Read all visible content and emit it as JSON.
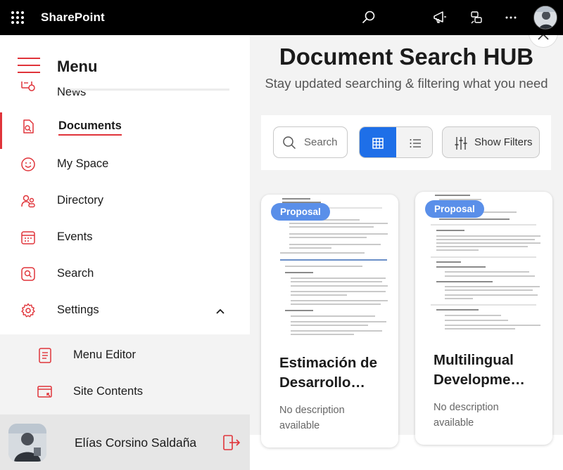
{
  "topbar": {
    "brand": "SharePoint",
    "icons": [
      "app-launcher-icon",
      "search-icon",
      "megaphone-icon",
      "feedback-icon",
      "more-icon"
    ]
  },
  "nav": {
    "title": "Menu",
    "items": [
      {
        "label": "News",
        "icon": "news-icon"
      },
      {
        "label": "Documents",
        "icon": "documents-search-icon",
        "active": true
      },
      {
        "label": "My Space",
        "icon": "smile-icon"
      },
      {
        "label": "Directory",
        "icon": "people-icon"
      },
      {
        "label": "Events",
        "icon": "calendar-icon"
      },
      {
        "label": "Search",
        "icon": "search-icon"
      },
      {
        "label": "Settings",
        "icon": "gear-icon",
        "expanded": true
      }
    ],
    "submenu": [
      {
        "label": "Menu Editor",
        "icon": "document-edit-icon"
      },
      {
        "label": "Site Contents",
        "icon": "site-contents-icon"
      }
    ],
    "user": {
      "name": "Elías Corsino Saldaña"
    }
  },
  "main": {
    "title": "Document Search HUB",
    "subtitle": "Stay updated searching & filtering what you need",
    "search_placeholder": "Search",
    "filters_label": "Show Filters",
    "cards": [
      {
        "badge": "Proposal",
        "title": "Estimación de Desarrollo…",
        "description": "No description available"
      },
      {
        "badge": "Proposal",
        "title": "Multilingual Developme…",
        "description": "No description available"
      }
    ]
  },
  "colors": {
    "accent": "#e0343a",
    "primary": "#1e6fe8",
    "badge": "#5a8fe9",
    "topbar": "#000000"
  }
}
